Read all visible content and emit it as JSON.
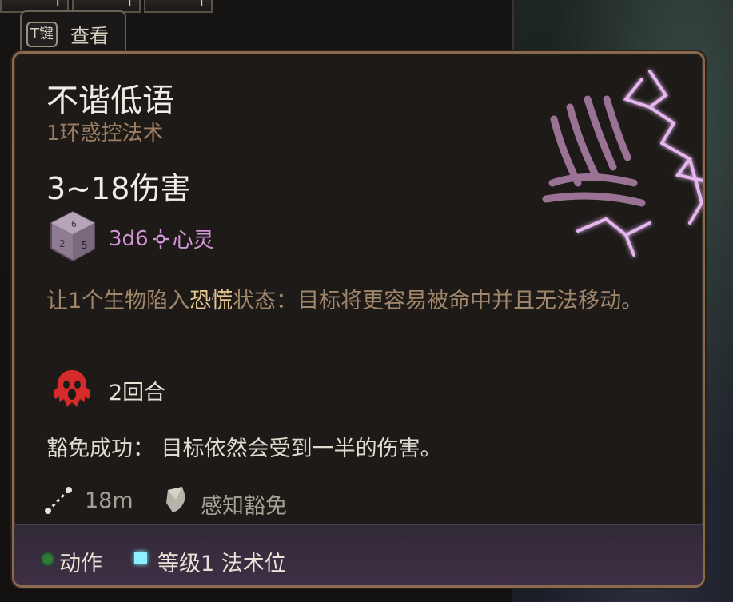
{
  "hotbar": [
    {
      "count": "1"
    },
    {
      "count": "1"
    },
    {
      "count": "1"
    }
  ],
  "hint": {
    "key": "T键",
    "label": "查看"
  },
  "tooltip": {
    "title": "不谐低语",
    "subtitle": "1环惑控法术",
    "damage": "3~18伤害",
    "dice": "3d6",
    "damage_type": "心灵",
    "description_pre": "让1个生物陷入",
    "description_keyword": "恐慌",
    "description_post": "状态：目标将更容易被命中并且无法移动。",
    "duration": "2回合",
    "save_success": "豁免成功： 目标依然会受到一半的伤害。",
    "range": "18m",
    "save_type": "感知豁免",
    "action": "动作",
    "cost": "等级1 法术位"
  },
  "colors": {
    "psychic": "#d294d6",
    "keyword": "#e6c793",
    "action_dot": "#2f7a3a",
    "spell_slot": "#8ef0ff",
    "frame": "#8a6a4e"
  },
  "icons": [
    "dice-icon",
    "psychic-icon",
    "frightened-icon",
    "range-icon",
    "shield-icon",
    "action-dot-icon",
    "spell-slot-icon",
    "whisper-spell-icon"
  ]
}
